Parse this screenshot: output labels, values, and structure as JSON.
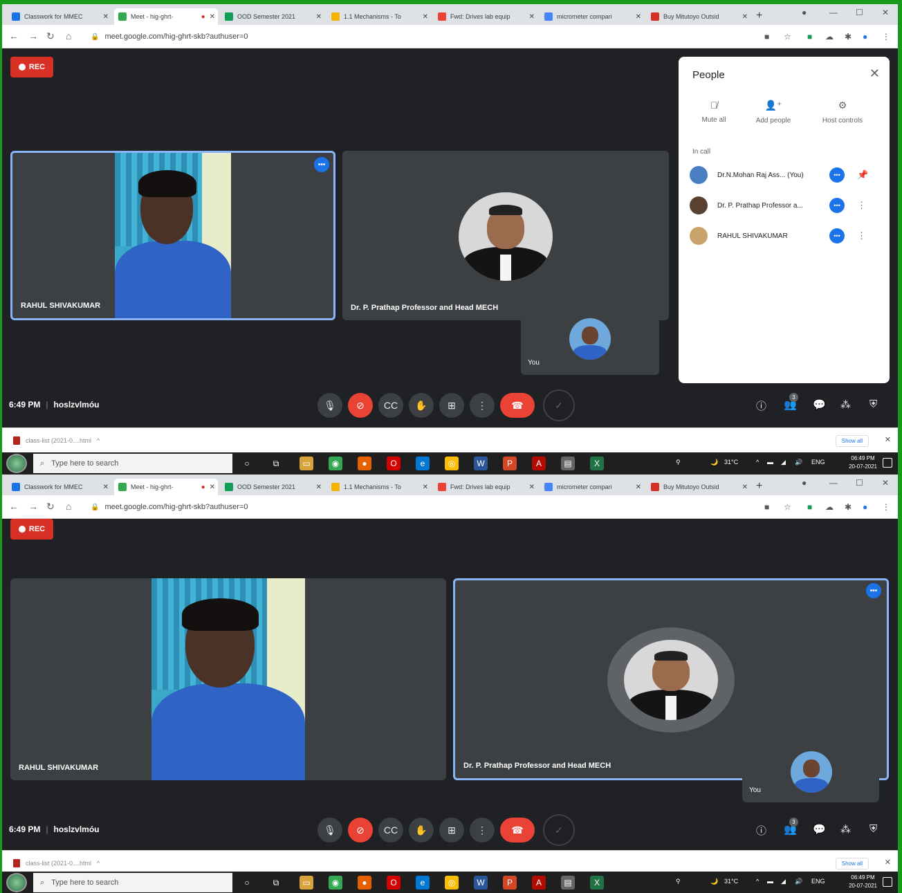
{
  "browser": {
    "tabs": [
      {
        "title": "Classwork for MMEC",
        "color": "#1a73e8",
        "active": false
      },
      {
        "title": "Meet - hig-ghrt-",
        "color": "#34a853",
        "active": true
      },
      {
        "title": "OOD Semester 2021",
        "color": "#0f9d58",
        "active": false
      },
      {
        "title": "1.1 Mechanisms - To",
        "color": "#f4b400",
        "active": false
      },
      {
        "title": "Fwd: Drives lab equip",
        "color": "#ea4335",
        "active": false
      },
      {
        "title": "micrometer compari",
        "color": "#4285f4",
        "active": false
      },
      {
        "title": "Buy Mitutoyo Outsid",
        "color": "#d93025",
        "active": false
      }
    ],
    "url": "meet.google.com/hig-ghrt-skb?authuser=0"
  },
  "meeting": {
    "rec_label": "REC",
    "participants": {
      "rahul": "RAHUL SHIVAKUMAR",
      "prathap": "Dr. P. Prathap Professor and Head MECH",
      "self": "You"
    },
    "time": "6:49 PM",
    "separator": "|",
    "code": "hoslzvlmóu",
    "people_badge": "3"
  },
  "people_panel": {
    "title": "People",
    "actions": [
      {
        "label": "Mute all",
        "icon": "mic-off-icon"
      },
      {
        "label": "Add people",
        "icon": "add-person-icon"
      },
      {
        "label": "Host controls",
        "icon": "host-controls-icon"
      }
    ],
    "section": "In call",
    "list": [
      {
        "name": "Dr.N.Mohan Raj Ass... (You)",
        "color": "#4a7fc1"
      },
      {
        "name": "Dr. P. Prathap Professor a...",
        "color": "#5a4030"
      },
      {
        "name": "RAHUL SHIVAKUMAR",
        "color": "#c9a46a"
      }
    ]
  },
  "downloads": {
    "file": "class-list (2021-0....html",
    "show_all": "Show all"
  },
  "taskbar": {
    "search_placeholder": "Type here to search",
    "temperature": "31°C",
    "lang": "ENG",
    "time": "06:49 PM",
    "date": "20-07-2021"
  },
  "colors": {
    "meet_bg": "#202124",
    "tile_bg": "#3c4043",
    "speaker_border": "#8ab4f8",
    "end_call": "#ea4335",
    "accent": "#1a73e8",
    "frame": "#1a9a1a"
  }
}
